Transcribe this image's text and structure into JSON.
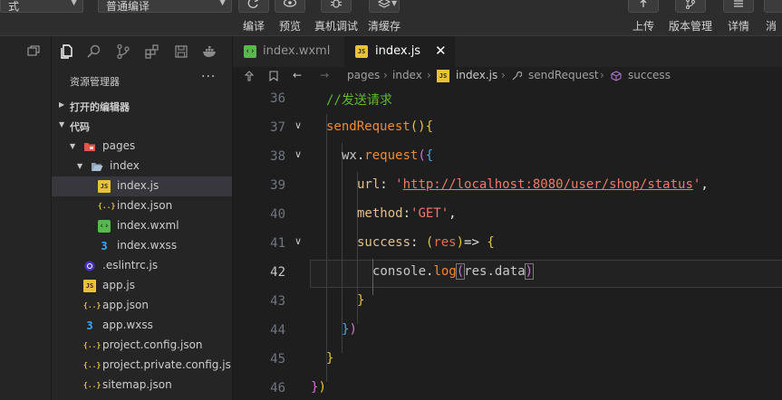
{
  "toolbar": {
    "mode_select": "式",
    "compile_select": "普通编译",
    "buttons": {
      "compile": "编译",
      "preview": "预览",
      "device_debug": "真机调试",
      "clear_cache": "清缓存",
      "upload": "上传",
      "version": "版本管理",
      "details": "详情",
      "notify": "消"
    }
  },
  "explorer": {
    "title": "资源管理器",
    "more": "···",
    "open_editors": "打开的编辑器",
    "code_section": "代码",
    "tree": [
      {
        "label": "pages",
        "icon": "folder-pages-icon"
      },
      {
        "label": "index",
        "icon": "folder-icon"
      },
      {
        "label": "index.js",
        "icon": "js-file-icon"
      },
      {
        "label": "index.json",
        "icon": "json-file-icon"
      },
      {
        "label": "index.wxml",
        "icon": "wxml-file-icon"
      },
      {
        "label": "index.wxss",
        "icon": "wxss-file-icon"
      },
      {
        "label": ".eslintrc.js",
        "icon": "eslint-file-icon"
      },
      {
        "label": "app.js",
        "icon": "js-file-icon"
      },
      {
        "label": "app.json",
        "icon": "json-file-icon"
      },
      {
        "label": "app.wxss",
        "icon": "wxss-file-icon"
      },
      {
        "label": "project.config.json",
        "icon": "json-file-icon"
      },
      {
        "label": "project.private.config.js...",
        "icon": "json-file-icon"
      },
      {
        "label": "sitemap.json",
        "icon": "json-file-icon"
      }
    ]
  },
  "tabs": [
    {
      "label": "index.wxml",
      "active": false
    },
    {
      "label": "index.js",
      "active": true
    }
  ],
  "breadcrumb": {
    "p1": "pages",
    "p2": "index",
    "p3": "index.js",
    "p4": "sendRequest",
    "p5": "success"
  },
  "editor": {
    "current_line": 42,
    "lines": [
      {
        "n": "36"
      },
      {
        "n": "37"
      },
      {
        "n": "38"
      },
      {
        "n": "39"
      },
      {
        "n": "40"
      },
      {
        "n": "41"
      },
      {
        "n": "42"
      },
      {
        "n": "43"
      },
      {
        "n": "44"
      },
      {
        "n": "45"
      },
      {
        "n": "46"
      }
    ],
    "code": {
      "l36": "//发送请求",
      "l37_fn": "sendRequest",
      "l38_obj": "wx",
      "l38_fn": "request",
      "l39_key": "url",
      "l39_val": "http://localhost:8080/user/shop/status",
      "l40_key": "method",
      "l40_val": "'GET'",
      "l41_key": "success",
      "l41_param": "res",
      "l42_obj": "console",
      "l42_fn": "log",
      "l42_arg": "res.data"
    }
  },
  "colors": {
    "background": "#1e1e1e",
    "sidebar": "#252526",
    "comment": "#5fb830",
    "function": "#f08b30",
    "string": "#f07a6a"
  }
}
